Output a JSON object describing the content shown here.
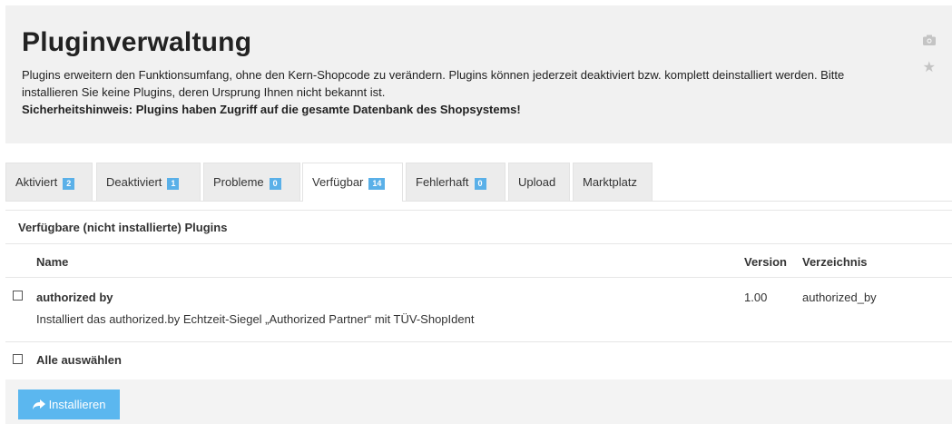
{
  "header": {
    "title": "Pluginverwaltung",
    "description_line1": "Plugins erweitern den Funktionsumfang, ohne den Kern-Shopcode zu verändern. Plugins können jederzeit deaktiviert bzw. komplett deinstalliert werden. Bitte installieren Sie keine Plugins, deren Ursprung Ihnen nicht bekannt ist.",
    "security_note": "Sicherheitshinweis: Plugins haben Zugriff auf die gesamte Datenbank des Shopsystems!",
    "icons": [
      "camera-icon",
      "star-icon"
    ]
  },
  "tabs": [
    {
      "label": "Aktiviert",
      "count": "2"
    },
    {
      "label": "Deaktiviert",
      "count": "1"
    },
    {
      "label": "Probleme",
      "count": "0"
    },
    {
      "label": "Verfügbar",
      "count": "14",
      "active": true
    },
    {
      "label": "Fehlerhaft",
      "count": "0"
    },
    {
      "label": "Upload"
    },
    {
      "label": "Marktplatz"
    }
  ],
  "panel": {
    "title": "Verfügbare (nicht installierte) Plugins",
    "columns": {
      "name": "Name",
      "version": "Version",
      "directory": "Verzeichnis"
    },
    "plugins": [
      {
        "name": "authorized by",
        "description": "Installiert das authorized.by Echtzeit-Siegel „Authorized Partner“ mit TÜV-ShopIdent",
        "version": "1.00",
        "directory": "authorized_by"
      }
    ],
    "select_all_label": "Alle auswählen",
    "install_button_label": "Installieren"
  },
  "colors": {
    "badge": "#5ab0e8",
    "install_button": "#5bb7ef",
    "header_bg": "#f1f1f1",
    "tab_bg": "#ececec"
  }
}
